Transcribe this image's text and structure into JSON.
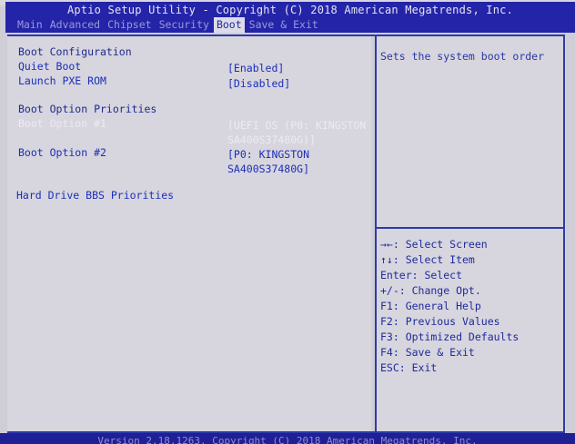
{
  "title": "Aptio Setup Utility - Copyright (C) 2018 American Megatrends, Inc.",
  "tabs": [
    {
      "label": "Main"
    },
    {
      "label": "Advanced"
    },
    {
      "label": "Chipset"
    },
    {
      "label": "Security"
    },
    {
      "label": "Boot"
    },
    {
      "label": "Save & Exit"
    }
  ],
  "main": {
    "boot_configuration": "Boot Configuration",
    "quiet_boot": {
      "label": "Quiet Boot",
      "value": "[Enabled]"
    },
    "launch_pxe_rom": {
      "label": "Launch PXE ROM",
      "value": "[Disabled]"
    },
    "boot_option_priorities": "Boot Option Priorities",
    "boot_option_1": {
      "label": "Boot Option #1",
      "value_line1": "[UEFI OS (P0: KINGSTON",
      "value_line2": "SA400S37480G)]"
    },
    "boot_option_2": {
      "label": "Boot Option #2",
      "value_line1": "[P0: KINGSTON",
      "value_line2": "SA400S37480G]"
    },
    "hard_drive_bbs": "Hard Drive BBS Priorities"
  },
  "help": {
    "description": "Sets the system boot order",
    "keys": [
      "→←: Select Screen",
      "↑↓: Select Item",
      "Enter: Select",
      "+/-: Change Opt.",
      "F1: General Help",
      "F2: Previous Values",
      "F3: Optimized Defaults",
      "F4: Save & Exit",
      "ESC: Exit"
    ]
  },
  "footer": {
    "version": "Version 2.18.1263. Copyright (C) 2018 American Megatrends, Inc."
  },
  "colors": {
    "title_bar": "#2424a8",
    "panel_background": "#d7d5de",
    "frame": "#2c3aa8",
    "highlight_text": "#eceaf4"
  }
}
